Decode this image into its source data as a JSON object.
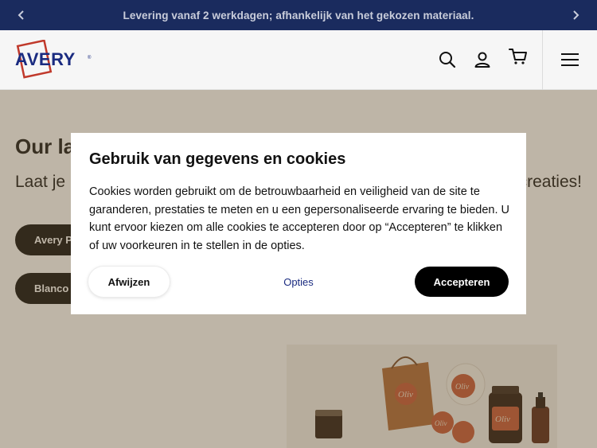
{
  "announcement": {
    "text": "Levering vanaf 2 werkdagen; afhankelijk van het gekozen materiaal.",
    "prev_icon": "chevron-left-icon",
    "next_icon": "chevron-right-icon"
  },
  "header": {
    "logo_text": "AVERY",
    "logo_mark": "®",
    "icons": [
      "search-icon",
      "user-icon",
      "cart-icon",
      "menu-icon"
    ]
  },
  "hero": {
    "title": "Our la",
    "subtitle_left": "Laat je i",
    "subtitle_right": "creaties!",
    "pills": [
      "Avery P",
      "Blanco"
    ]
  },
  "cookie_dialog": {
    "title": "Gebruik van gegevens en cookies",
    "body": "Cookies worden gebruikt om de betrouwbaarheid en veiligheid van de site te garanderen, prestaties te meten en u een gepersonaliseerde ervaring te bieden. U kunt ervoor kiezen om alle cookies te accepteren door op “Accepteren” te klikken of uw voorkeuren in te stellen in de opties.",
    "reject_label": "Afwijzen",
    "options_label": "Opties",
    "accept_label": "Accepteren"
  },
  "product_labels": [
    "Oliv",
    "Oliv",
    "Oliv",
    "Oliv"
  ],
  "colors": {
    "topbar": "#1a2b5e",
    "logo_red": "#c0392b",
    "logo_blue": "#1a2b80",
    "accent_dark": "#111111"
  }
}
